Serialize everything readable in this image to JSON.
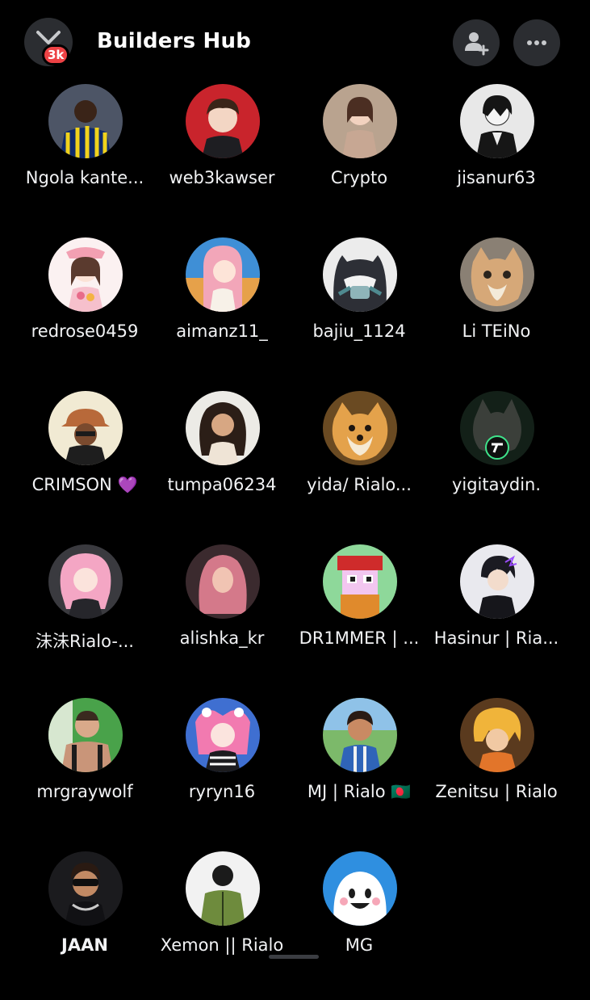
{
  "header": {
    "title": "Builders Hub",
    "notification_badge": "3k",
    "back_icon": "back-arrow-icon",
    "add_member_icon": "add-friend-icon",
    "more_icon": "ellipsis-icon"
  },
  "members": [
    {
      "name": "Ngola kante..."
    },
    {
      "name": "web3kawser"
    },
    {
      "name": "Crypto"
    },
    {
      "name": "jisanur63"
    },
    {
      "name": "redrose0459"
    },
    {
      "name": "aimanz11_"
    },
    {
      "name": "bajiu_1124"
    },
    {
      "name": "Li TEiNo"
    },
    {
      "name": "CRIMSON",
      "emoji": "💜"
    },
    {
      "name": "tumpa06234"
    },
    {
      "name": "yida/ Rialo..."
    },
    {
      "name": "yigitaydin."
    },
    {
      "name": "沬沬Rialo-..."
    },
    {
      "name": "alishka_kr"
    },
    {
      "name": "DR1MMER | ..."
    },
    {
      "name": "Hasinur | Ria..."
    },
    {
      "name": "mrgraywolf"
    },
    {
      "name": "ryryn16"
    },
    {
      "name": "MJ | Rialo",
      "emoji": "🇧🇩"
    },
    {
      "name": "Zenitsu | Rialo"
    },
    {
      "name": "JAAN",
      "bold": true
    },
    {
      "name": "Xemon || Rialo"
    },
    {
      "name": "MG"
    }
  ],
  "colors": {
    "background": "#000000",
    "button_bg": "#2b2d31",
    "badge": "#ed4245"
  }
}
